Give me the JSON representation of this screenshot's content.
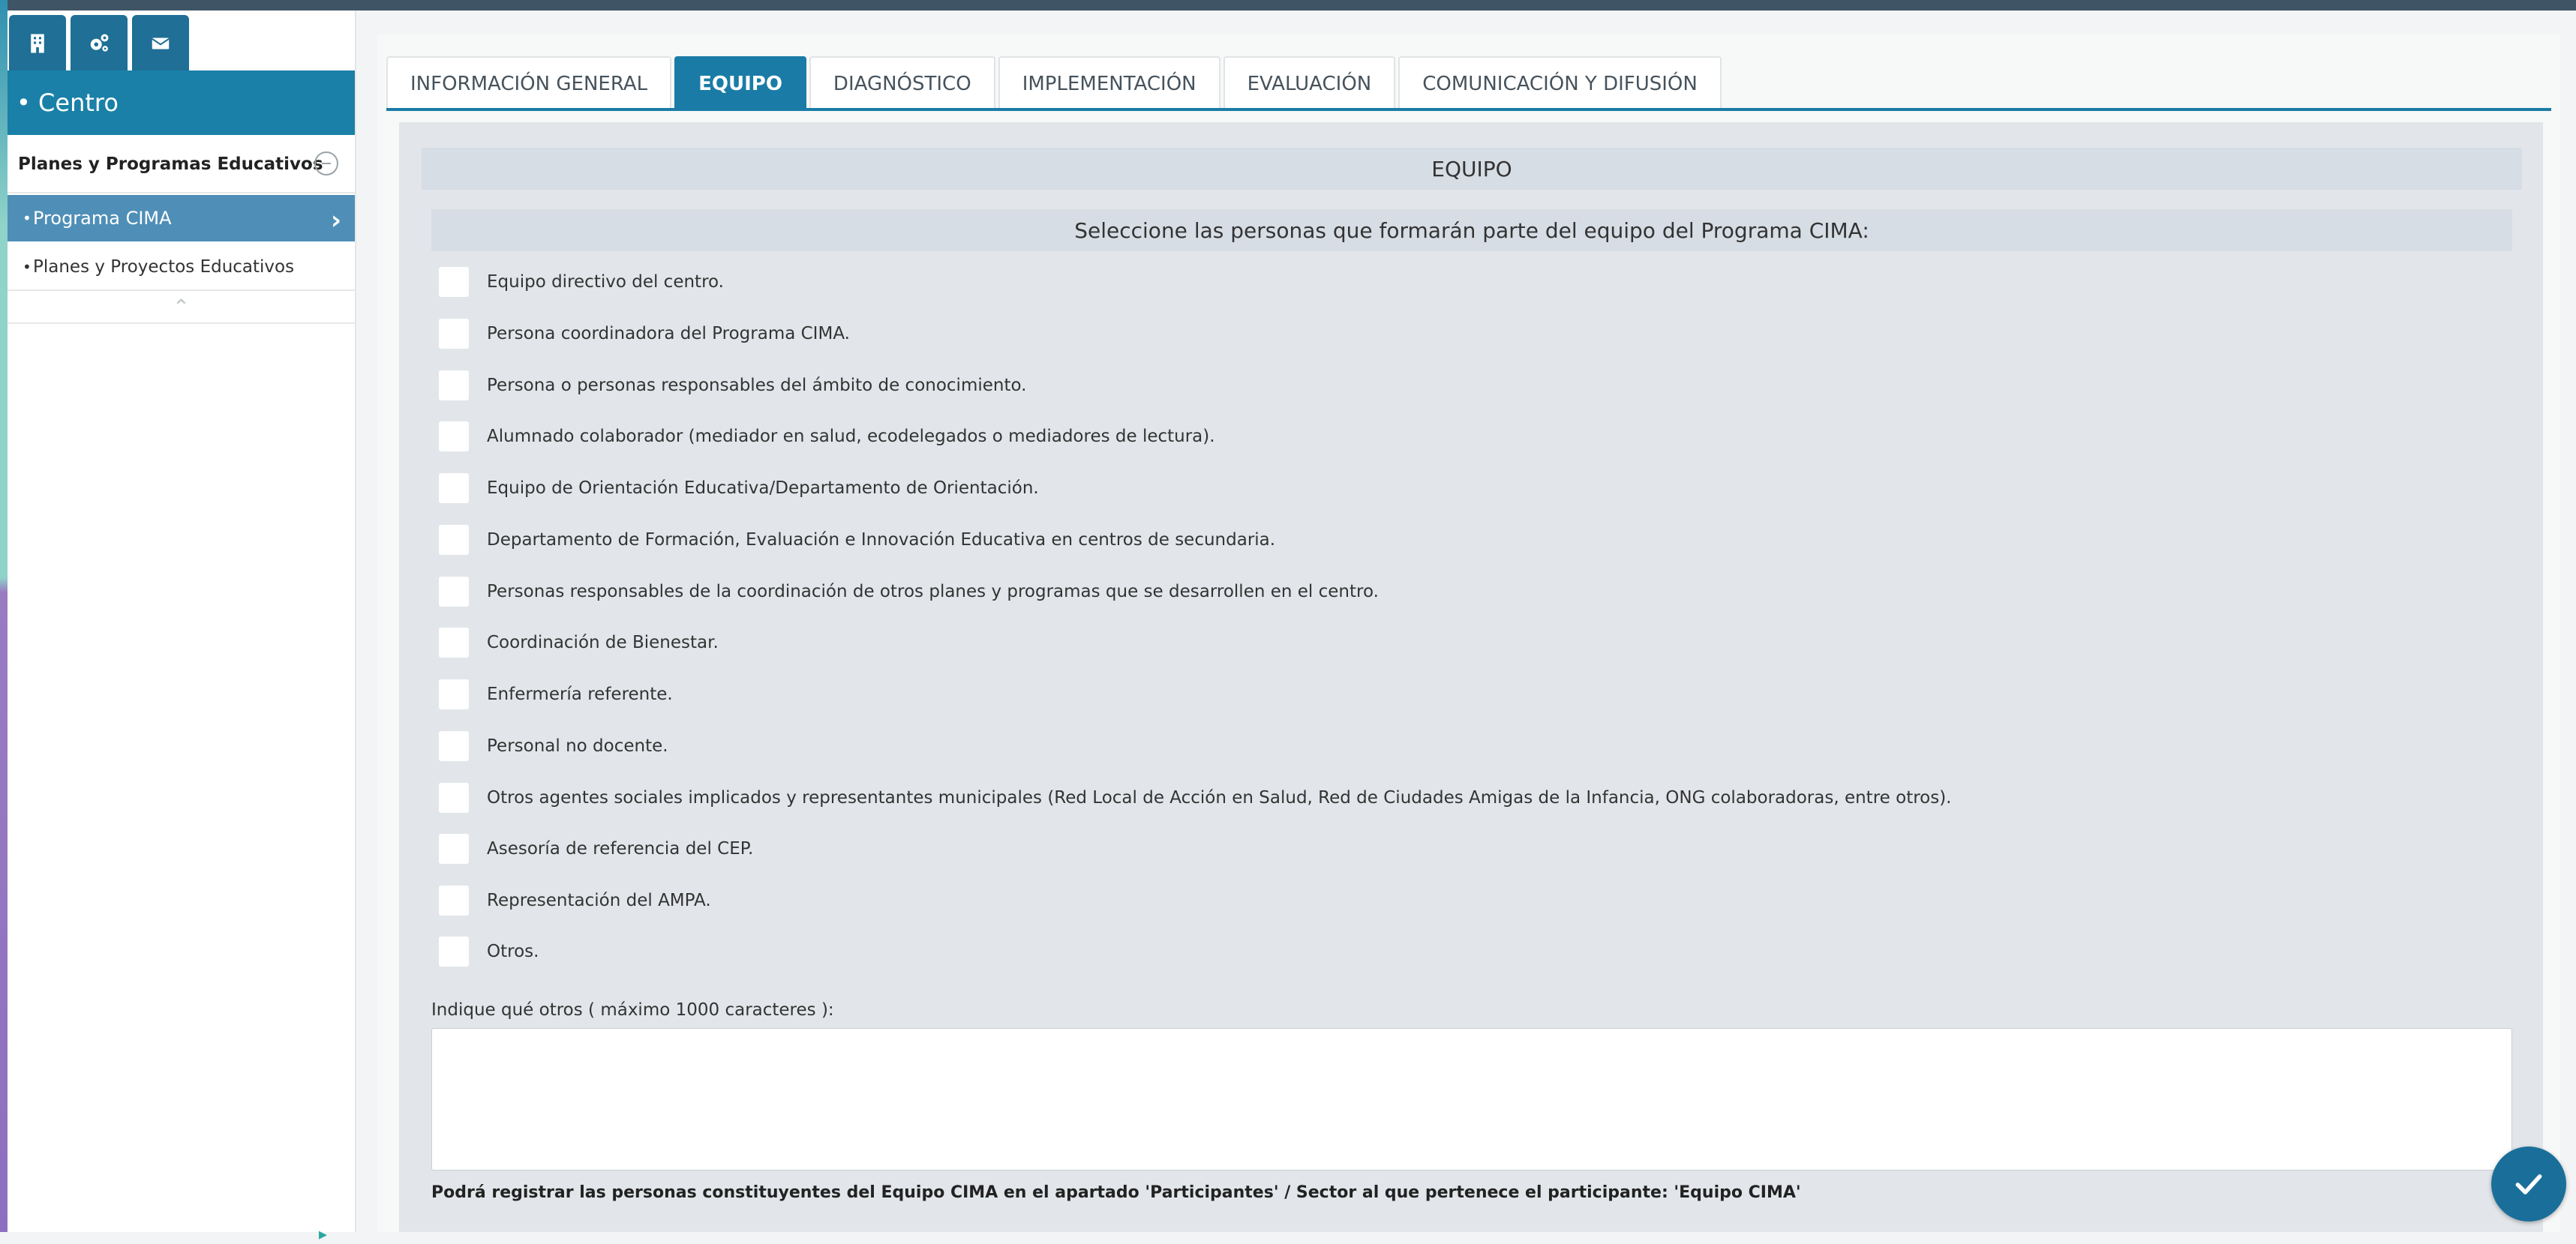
{
  "sidebar": {
    "icons": [
      "building-icon",
      "cogs-icon",
      "envelope-icon"
    ],
    "header": "• Centro",
    "group_label": "Planes y Programas Educativos",
    "items": [
      {
        "label": "Programa CIMA",
        "active": true
      },
      {
        "label": "Planes y Proyectos Educativos",
        "active": false
      }
    ]
  },
  "tabs": [
    {
      "label": "INFORMACIÓN GENERAL",
      "active": false
    },
    {
      "label": "EQUIPO",
      "active": true
    },
    {
      "label": "DIAGNÓSTICO",
      "active": false
    },
    {
      "label": "IMPLEMENTACIÓN",
      "active": false
    },
    {
      "label": "EVALUACIÓN",
      "active": false
    },
    {
      "label": "COMUNICACIÓN Y DIFUSIÓN",
      "active": false
    }
  ],
  "section": {
    "title": "EQUIPO",
    "subtitle": "Seleccione las personas que formarán parte del equipo del Programa CIMA:"
  },
  "options": [
    {
      "label": "Equipo directivo del centro.",
      "checked": false
    },
    {
      "label": "Persona coordinadora del Programa CIMA.",
      "checked": false
    },
    {
      "label": "Persona o personas responsables del ámbito de conocimiento.",
      "checked": false
    },
    {
      "label": "Alumnado colaborador (mediador en salud, ecodelegados o mediadores de lectura).",
      "checked": false
    },
    {
      "label": "Equipo de Orientación Educativa/Departamento de Orientación.",
      "checked": false
    },
    {
      "label": "Departamento de Formación, Evaluación e Innovación Educativa en centros de secundaria.",
      "checked": false
    },
    {
      "label": "Personas responsables de la coordinación de otros planes y programas que se desarrollen en el centro.",
      "checked": false
    },
    {
      "label": "Coordinación de Bienestar.",
      "checked": false
    },
    {
      "label": "Enfermería referente.",
      "checked": false
    },
    {
      "label": "Personal no docente.",
      "checked": false
    },
    {
      "label": "Otros agentes sociales implicados y representantes municipales (Red Local de Acción en Salud, Red de Ciudades Amigas de la Infancia, ONG colaboradoras, entre otros).",
      "checked": false
    },
    {
      "label": "Asesoría de referencia del CEP.",
      "checked": false
    },
    {
      "label": "Representación del AMPA.",
      "checked": false
    },
    {
      "label": "Otros.",
      "checked": false
    }
  ],
  "otros": {
    "label": "Indique qué otros ( máximo 1000 caracteres ):",
    "value": ""
  },
  "footnote": "Podrá registrar las personas constituyentes del Equipo CIMA en el apartado 'Participantes' / Sector al que pertenece el participante: 'Equipo CIMA'",
  "colors": {
    "accent": "#1a7ca6",
    "active_item": "#4f8fb7",
    "panel": "#e2e6ea"
  },
  "fab_icon": "check-icon"
}
